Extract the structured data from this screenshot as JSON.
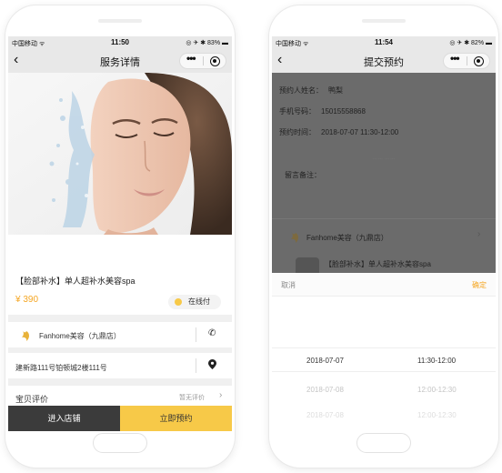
{
  "left_phone": {
    "status": {
      "carrier": "中国移动 ᯤ",
      "time": "11:50",
      "icons": "◎ ✈ ✱ 83% ▬"
    },
    "nav": {
      "title": "服务详情",
      "back_icon": "chevron-left-icon",
      "more_icon": "more-dots-icon",
      "close_icon": "target-circle-icon"
    },
    "product": {
      "title": "【脸部补水】单人超补水美容spa",
      "price": "¥ 390",
      "payment_badge": "在线付"
    },
    "store": {
      "name": "Fanhome美容（九鼎店）",
      "phone_icon": "phone-icon"
    },
    "address": {
      "text": "建新路111号铂顿城2楼111号",
      "location_icon": "map-pin-icon"
    },
    "review": {
      "label": "宝贝评价",
      "empty": "暂无评价",
      "arrow": "›"
    },
    "footer": {
      "enter_label": "进入店铺",
      "book_label": "立即预约"
    },
    "accent_color": "#f7c948"
  },
  "right_phone": {
    "status": {
      "carrier": "中国移动 ᯤ",
      "time": "11:54",
      "icons": "◎ ✈ ✱ 82% ▬"
    },
    "nav": {
      "title": "提交预约",
      "back_icon": "chevron-left-icon",
      "more_icon": "more-dots-icon",
      "close_icon": "target-circle-icon"
    },
    "form": {
      "name_label": "预约人姓名：",
      "name_value": "鸭梨",
      "phone_label": "手机号码：",
      "phone_value": "15015558868",
      "time_label": "预约时间：",
      "time_value": "2018-07-07 11:30-12:00",
      "hint": "…… ……",
      "message_label": "留言备注："
    },
    "store": {
      "name": "Fanhome美容（九鼎店）",
      "arrow": "›"
    },
    "product_name": "【脸部补水】单人超补水美容spa",
    "picker": {
      "cancel": "取消",
      "confirm": "确定",
      "rows": [
        {
          "date": "2018-07-07",
          "time": "11:30-12:00"
        },
        {
          "date": "2018-07-08",
          "time": "12:00-12:30"
        },
        {
          "date": "2018-07-08",
          "time": "12:00-12:30"
        }
      ]
    }
  }
}
